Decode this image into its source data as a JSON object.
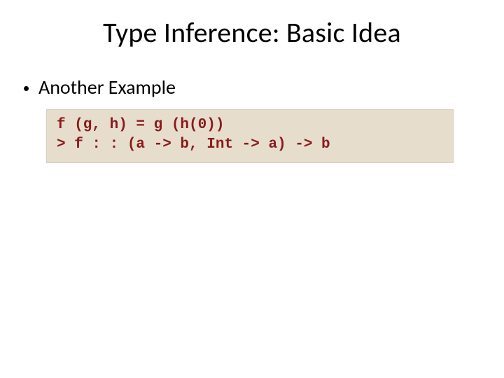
{
  "title": "Type Inference: Basic Idea",
  "bullet": "Another Example",
  "code": {
    "line1": "f (g, h) = g (h(0))",
    "line2": "> f : : (a -> b, Int -> a) -> b"
  }
}
